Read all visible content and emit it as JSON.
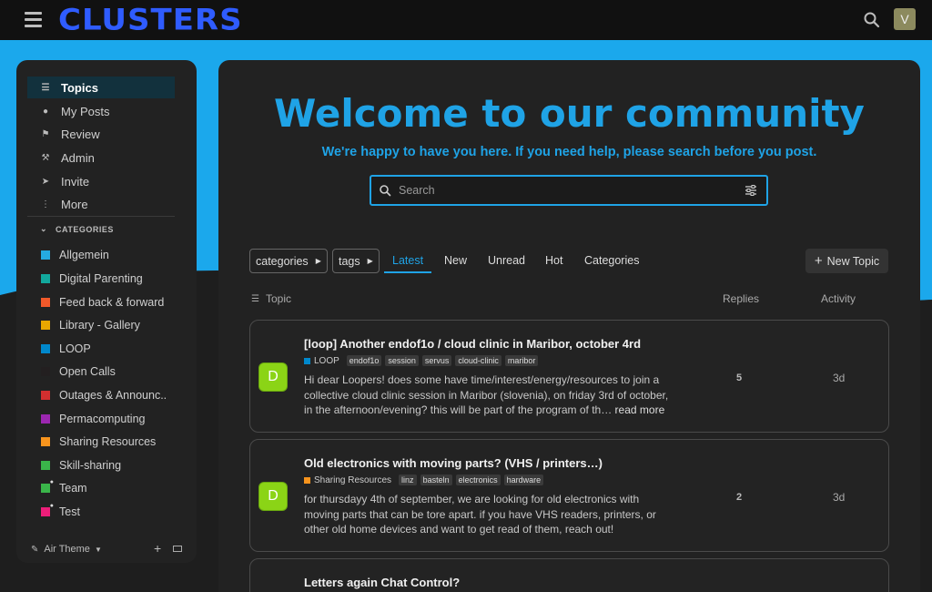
{
  "header": {
    "logo": "CLUSTERS",
    "user_initial": "V"
  },
  "colors": {
    "accent": "#1fa3e6",
    "logo": "#2f5cff",
    "background_wave": "#1ba8ec"
  },
  "sidebar": {
    "nav": [
      {
        "label": "Topics",
        "icon": "layers-icon",
        "active": true
      },
      {
        "label": "My Posts",
        "icon": "user-icon"
      },
      {
        "label": "Review",
        "icon": "flag-icon"
      },
      {
        "label": "Admin",
        "icon": "wrench-icon"
      },
      {
        "label": "Invite",
        "icon": "send-icon"
      },
      {
        "label": "More",
        "icon": "more-vertical-icon"
      }
    ],
    "categories_heading": "CATEGORIES",
    "categories": [
      {
        "label": "Allgemein",
        "color": "#25aae1"
      },
      {
        "label": "Digital Parenting",
        "color": "#12a89d"
      },
      {
        "label": "Feed back & forward",
        "color": "#f1592a"
      },
      {
        "label": "Library - Gallery",
        "color": "#e9a700"
      },
      {
        "label": "LOOP",
        "color": "#0088cc"
      },
      {
        "label": "Open Calls",
        "color": "#231f20"
      },
      {
        "label": "Outages & Announc..",
        "color": "#d32f2f"
      },
      {
        "label": "Permacomputing",
        "color": "#9c27b0"
      },
      {
        "label": "Sharing Resources",
        "color": "#f7941d"
      },
      {
        "label": "Skill-sharing",
        "color": "#3ab54a"
      },
      {
        "label": "Team",
        "color": "#3ab54a",
        "locked": true
      },
      {
        "label": "Test",
        "color": "#ec1e79",
        "locked": true
      }
    ],
    "footer": {
      "theme_label": "Air Theme"
    }
  },
  "main": {
    "welcome_title": "Welcome to our community",
    "welcome_subtitle": "We're happy to have you here. If you need help, please search before you post.",
    "search_placeholder": "Search",
    "filters": {
      "categories": "categories",
      "tags": "tags"
    },
    "tabs": [
      "Latest",
      "New",
      "Unread",
      "Hot",
      "Categories"
    ],
    "new_topic": "New Topic",
    "columns": {
      "topic": "Topic",
      "replies": "Replies",
      "activity": "Activity"
    },
    "topics": [
      {
        "title": "[loop] Another endof1o / cloud clinic in Maribor, october 4rd",
        "category": "LOOP",
        "category_color": "#0088cc",
        "tags": [
          "endof1o",
          "session",
          "servus",
          "cloud-clinic",
          "maribor"
        ],
        "excerpt": "Hi dear Loopers! does some have time/interest/energy/resources to join a collective cloud clinic session in Maribor (slovenia), on friday 3rd of october, in the afternoon/evening? this will be part of the program of th…",
        "read_more": "read more",
        "avatar": "D",
        "replies": "5",
        "activity": "3d"
      },
      {
        "title": "Old electronics with moving parts? (VHS / printers…)",
        "category": "Sharing Resources",
        "category_color": "#f7941d",
        "tags": [
          "linz",
          "basteln",
          "electronics",
          "hardware"
        ],
        "excerpt": "for thursdayy 4th of september, we are looking for old electronics with moving parts that can be tore apart. if you have VHS readers, printers, or other old home devices and want to get read of them, reach out!",
        "avatar": "D",
        "replies": "2",
        "activity": "3d"
      },
      {
        "title": "Letters again Chat Control?"
      }
    ]
  }
}
